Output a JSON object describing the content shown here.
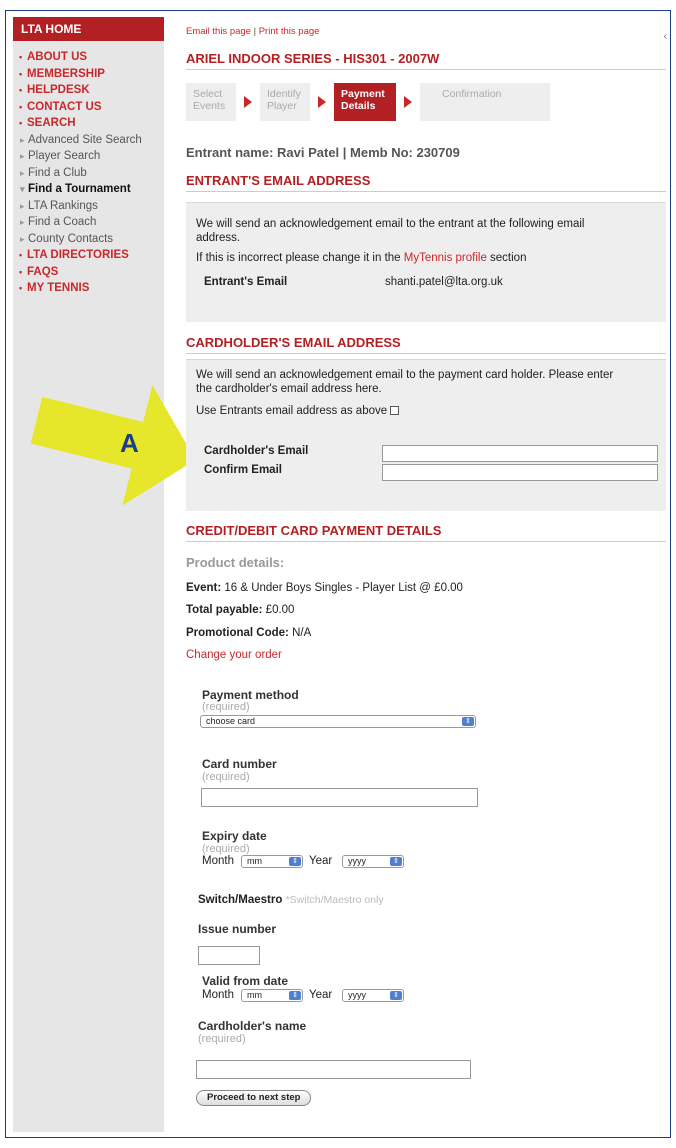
{
  "sidebar": {
    "home": "LTA HOME",
    "items": [
      {
        "label": "ABOUT US",
        "kind": "red"
      },
      {
        "label": "MEMBERSHIP",
        "kind": "red"
      },
      {
        "label": "HELPDESK",
        "kind": "red"
      },
      {
        "label": "CONTACT US",
        "kind": "red"
      },
      {
        "label": "SEARCH",
        "kind": "red"
      },
      {
        "label": "Advanced Site Search",
        "kind": "sub"
      },
      {
        "label": "Player Search",
        "kind": "sub"
      },
      {
        "label": "Find a Club",
        "kind": "sub"
      },
      {
        "label": "Find a Tournament",
        "kind": "active"
      },
      {
        "label": "LTA Rankings",
        "kind": "sub"
      },
      {
        "label": "Find a Coach",
        "kind": "sub"
      },
      {
        "label": "County Contacts",
        "kind": "sub"
      },
      {
        "label": "LTA DIRECTORIES",
        "kind": "red"
      },
      {
        "label": "FAQS",
        "kind": "red"
      },
      {
        "label": "MY TENNIS",
        "kind": "red"
      }
    ]
  },
  "toplinks": {
    "email": "Email this page",
    "separator": "|",
    "print": "Print this page"
  },
  "page_heading": "ARIEL INDOOR SERIES - HIS301 - 2007W",
  "steps": {
    "s1": [
      "Select",
      "Events"
    ],
    "s2": [
      "Identify",
      "Player"
    ],
    "s3": [
      "Payment",
      "Details"
    ],
    "s4": [
      "Confirmation"
    ]
  },
  "entrant_line": "Entrant name: Ravi Patel | Memb No: 230709",
  "entrant_email": {
    "title": "ENTRANT'S EMAIL ADDRESS",
    "line1": "We will send an acknowledgement email to the entrant at the following email",
    "line2": "address.",
    "line3_pre": "If this is incorrect please change it in the ",
    "line3_link": "MyTennis profile",
    "line3_post": " section",
    "label": "Entrant's Email",
    "value": "shanti.patel@lta.org.uk"
  },
  "cardholder_email": {
    "title": "CARDHOLDER'S EMAIL ADDRESS",
    "line1": "We will send an acknowledgement email to the payment card holder. Please enter",
    "line2": "the cardholder's email address here.",
    "use_entrant": "Use Entrants email address as above",
    "email_label": "Cardholder's Email",
    "confirm_label": "Confirm Email"
  },
  "callout": {
    "letter": "A",
    "color": "#e6e62a"
  },
  "payment": {
    "title": "CREDIT/DEBIT CARD PAYMENT DETAILS",
    "product_heading": "Product details:",
    "event_label": "Event:",
    "event_value": "16 & Under Boys Singles - Player List @ £0.00",
    "total_label": "Total payable:",
    "total_value": "£0.00",
    "promo_label": "Promotional Code:",
    "promo_value": "N/A",
    "change_order": "Change your order",
    "method_label": "Payment method",
    "required": "(required)",
    "method_value": "choose card",
    "card_label": "Card number",
    "expiry_label": "Expiry date",
    "month_label": "Month",
    "month_value": "mm",
    "year_label": "Year",
    "year_value": "yyyy",
    "switch_label": "Switch/Maestro",
    "switch_note": "*Switch/Maestro only",
    "issue_label": "Issue number",
    "valid_label": "Valid from date",
    "name_label": "Cardholder's name",
    "proceed": "Proceed to next step"
  }
}
